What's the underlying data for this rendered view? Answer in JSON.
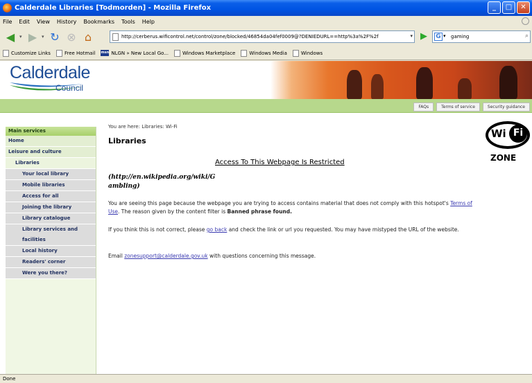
{
  "window": {
    "title": "Calderdale Libraries [Todmorden] - Mozilla Firefox",
    "min": "_",
    "max": "□",
    "close": "✕"
  },
  "menu": [
    "File",
    "Edit",
    "View",
    "History",
    "Bookmarks",
    "Tools",
    "Help"
  ],
  "nav": {
    "url": "http://cerberus.wificontrol.net/control/zone/blocked/46854da04fef0009@?DENIEDURL==http%3a%2F%2f",
    "search_value": "gaming"
  },
  "bookmarks": [
    "Customize Links",
    "Free Hotmail",
    "NLGN » New Local Go...",
    "Windows Marketplace",
    "Windows Media",
    "Windows"
  ],
  "site": {
    "logo_main": "Calderdale",
    "logo_sub": "Council",
    "top_links": [
      "FAQs",
      "Terms of service",
      "Security guidance"
    ]
  },
  "sidebar": {
    "heading": "Main services",
    "items": [
      {
        "label": "Home",
        "level": 1
      },
      {
        "label": "Leisure and culture",
        "level": 1
      },
      {
        "label": "Libraries",
        "level": 2
      },
      {
        "label": "Your local library",
        "level": 3
      },
      {
        "label": "Mobile libraries",
        "level": 3
      },
      {
        "label": "Access for all",
        "level": 3
      },
      {
        "label": "Joining the library",
        "level": 3
      },
      {
        "label": "Library catalogue",
        "level": 3
      },
      {
        "label": "Library services and facilities",
        "level": 3
      },
      {
        "label": "Local history",
        "level": 3
      },
      {
        "label": "Readers' corner",
        "level": 3
      },
      {
        "label": "Were you there?",
        "level": 3
      }
    ]
  },
  "main": {
    "breadcrumb": "You are here: Libraries: Wi-Fi",
    "title": "Libraries",
    "wifi_wi": "Wi",
    "wifi_fi": "Fi",
    "wifi_zone": "ZONE",
    "restricted_heading": "Access To This Webpage Is Restricted",
    "blocked_url_line1": "(http://en.wikipedia.org/wiki/G",
    "blocked_url_line2": "ambling)",
    "p1_a": "You are seeing this page because the webpage you are trying to access contains material that does not comply with this hotspot's ",
    "p1_link": "Terms of Use",
    "p1_b": ". The reason given by the content filter is ",
    "p1_reason": "Banned phrase found.",
    "p2_a": "If you think this is not correct, please ",
    "p2_link": "go back",
    "p2_b": " and check the link or url you requested. You may have mistyped the URL of the website.",
    "p3_a": "Email ",
    "p3_link": "zonesupport@calderdale.gov.uk",
    "p3_b": " with questions concerning this message."
  },
  "status": "Done"
}
